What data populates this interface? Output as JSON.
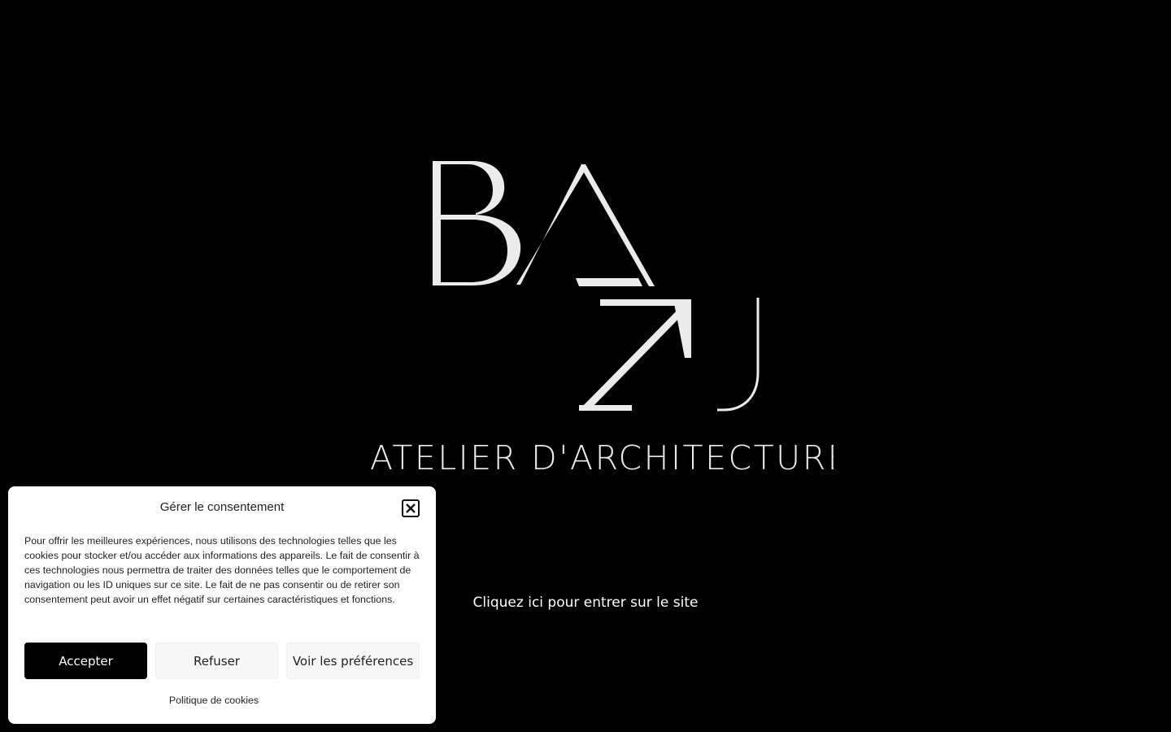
{
  "page": {
    "background": "#000000",
    "logo_letters": "BAZU",
    "tagline": "ATELIER D'ARCHITECTURE",
    "enter_link": "Cliquez ici pour entrer sur le site"
  },
  "consent": {
    "title": "Gérer le consentement",
    "close_icon": "close-x-icon",
    "text": "Pour offrir les meilleures expériences, nous utilisons des technologies telles que les cookies pour stocker et/ou accéder aux informations des appareils. Le fait de consentir à ces technologies nous permettra de traiter des données telles que le comportement de navigation ou les ID uniques sur ce site. Le fait de ne pas consentir ou de retirer son consentement peut avoir un effet négatif sur certaines caractéristiques et fonctions.",
    "accept_label": "Accepter",
    "refuse_label": "Refuser",
    "prefs_label": "Voir les préférences",
    "policy_label": "Politique de cookies",
    "accept_color": "#000000"
  }
}
